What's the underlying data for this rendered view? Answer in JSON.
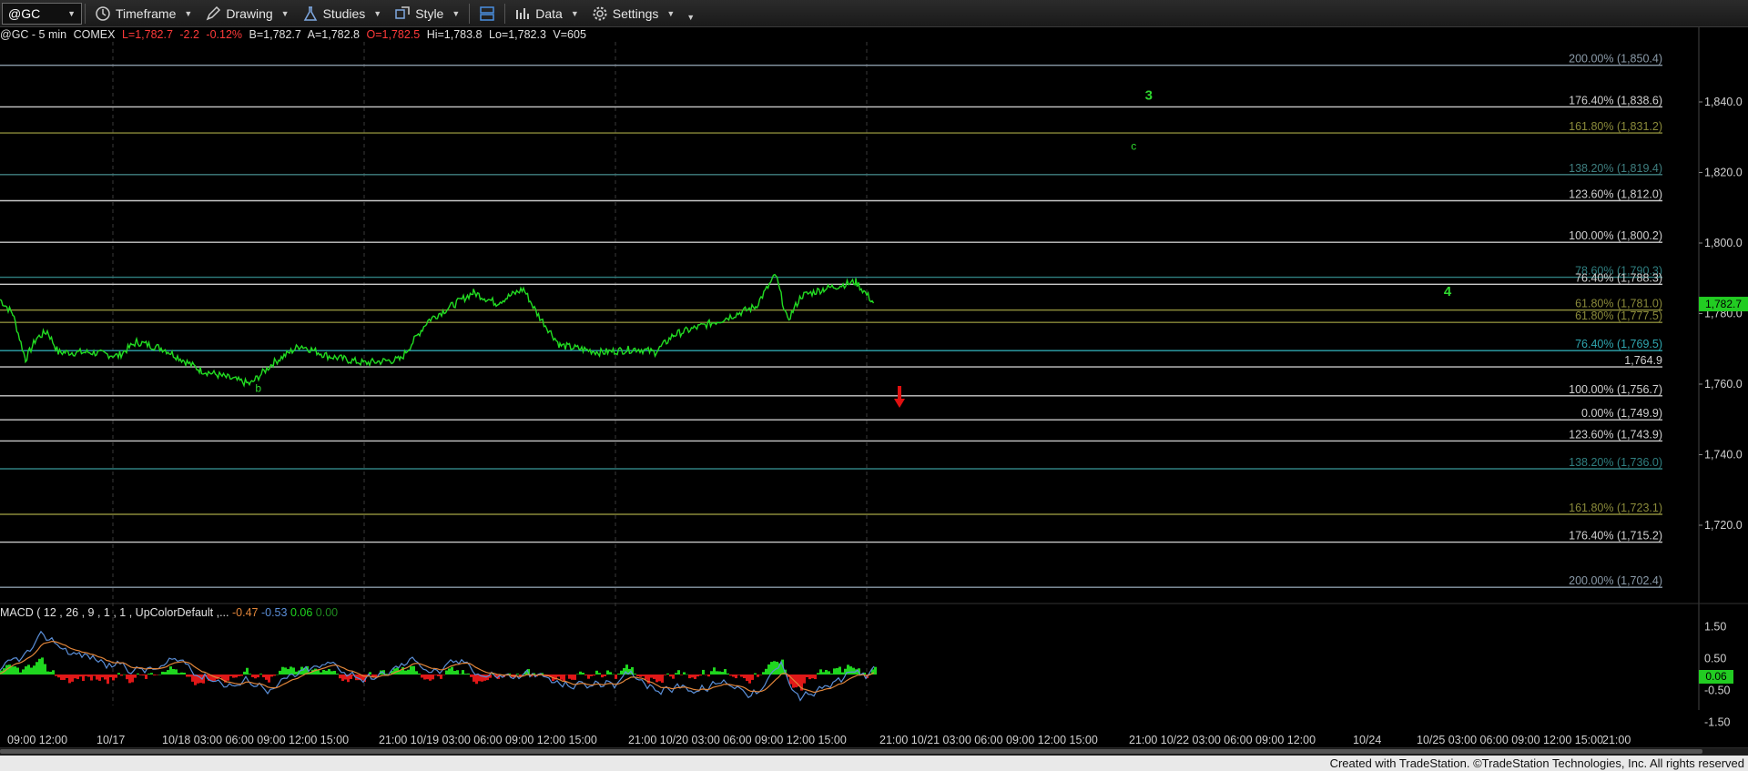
{
  "toolbar": {
    "symbol": "@GC",
    "timeframe": "Timeframe",
    "drawing": "Drawing",
    "studies": "Studies",
    "style": "Style",
    "data": "Data",
    "settings": "Settings"
  },
  "status": {
    "symbol": "@GC - 5 min",
    "exchange": "COMEX",
    "last": "L=1,782.7",
    "change": "-2.2",
    "pct": "-0.12%",
    "bid": "B=1,782.7",
    "ask": "A=1,782.8",
    "open": "O=1,782.5",
    "high": "Hi=1,783.8",
    "low": "Lo=1,782.3",
    "volume": "V=605"
  },
  "macd": {
    "label": "MACD ( 12 , 26 , 9 , 1 , 1 , UpColorDefault ,...",
    "v1": "-0.47",
    "v2": "-0.53",
    "v3": "0.06",
    "v4": "0.00",
    "axis": [
      "1.50",
      "0.50",
      "-0.50",
      "-1.50"
    ],
    "badge": "0.06"
  },
  "price_axis": [
    "1,840.0",
    "1,820.0",
    "1,800.0",
    "1,780.0",
    "1,760.0",
    "1,740.0",
    "1,720.0"
  ],
  "last_price_badge": "1,782.7",
  "fib_levels": [
    {
      "label": "200.00% (1,850.4)",
      "price": 1850.4,
      "color": "#8a9aa8"
    },
    {
      "label": "176.40% (1,838.6)",
      "price": 1838.6,
      "color": "#c8c8c8"
    },
    {
      "label": "161.80% (1,831.2)",
      "price": 1831.2,
      "color": "#8a8a3a"
    },
    {
      "label": "138.20% (1,819.4)",
      "price": 1819.4,
      "color": "#3f7f80"
    },
    {
      "label": "123.60% (1,812.0)",
      "price": 1812.0,
      "color": "#c8c8c8"
    },
    {
      "label": "100.00% (1,800.2)",
      "price": 1800.2,
      "color": "#c8c8c8"
    },
    {
      "label": "78.60% (1,790.3)",
      "price": 1790.3,
      "color": "#2f7f80"
    },
    {
      "label": "76.40% (1,788.3)",
      "price": 1788.3,
      "color": "#c8c8c8"
    },
    {
      "label": "61.80% (1,781.0)",
      "price": 1781.0,
      "color": "#8a8a3a"
    },
    {
      "label": "61.80% (1,777.5)",
      "price": 1777.5,
      "color": "#8a8a3a"
    },
    {
      "label": "76.40% (1,769.5)",
      "price": 1769.5,
      "color": "#2fa7b0"
    },
    {
      "label": "1,764.9",
      "price": 1764.9,
      "color": "#c8c8c8"
    },
    {
      "label": "100.00% (1,756.7)",
      "price": 1756.7,
      "color": "#c8c8c8"
    },
    {
      "label": "0.00% (1,749.9)",
      "price": 1749.9,
      "color": "#c8c8c8"
    },
    {
      "label": "123.60% (1,743.9)",
      "price": 1743.9,
      "color": "#c8c8c8"
    },
    {
      "label": "138.20% (1,736.0)",
      "price": 1736.0,
      "color": "#2f7f80"
    },
    {
      "label": "161.80% (1,723.1)",
      "price": 1723.1,
      "color": "#8a8a3a"
    },
    {
      "label": "176.40% (1,715.2)",
      "price": 1715.2,
      "color": "#c8c8c8"
    },
    {
      "label": "200.00% (1,702.4)",
      "price": 1702.4,
      "color": "#8a9aa8"
    }
  ],
  "wave_labels": [
    {
      "text": "3",
      "price": 1840.6,
      "slot": 0.655,
      "color": "#2fd82f",
      "size": "big"
    },
    {
      "text": "c",
      "price": 1826.5,
      "slot": 0.647,
      "color": "#2fd82f",
      "size": "small"
    },
    {
      "text": "4",
      "price": 1785.0,
      "slot": 0.826,
      "color": "#2fd82f",
      "size": "big"
    },
    {
      "text": "b",
      "price": 1757.8,
      "slot": 0.146,
      "color": "#2fd82f",
      "size": "small"
    }
  ],
  "time_axis": [
    "09:00 12:00",
    "10/17",
    "10/18 03:00 06:00 09:00 12:00 15:00",
    "21:00 10/19 03:00 06:00 09:00 12:00 15:00",
    "21:00 10/20 03:00 06:00 09:00 12:00 15:00",
    "21:00 10/21 03:00 06:00 09:00 12:00 15:00",
    "21:00 10/22 03:00 06:00 09:00 12:00",
    "10/24",
    "10/25 03:00 06:00 09:00 12:00 15:00",
    "21:00"
  ],
  "footer": "Created with TradeStation. ©TradeStation Technologies, Inc. All rights reserved",
  "colors": {
    "price_line": "#22dd22",
    "arrow": "#e01010",
    "macd_up": "#1fd61f",
    "macd_down": "#e01818",
    "macd_line": "#5b8fd8",
    "signal_line": "#e0853a"
  }
}
